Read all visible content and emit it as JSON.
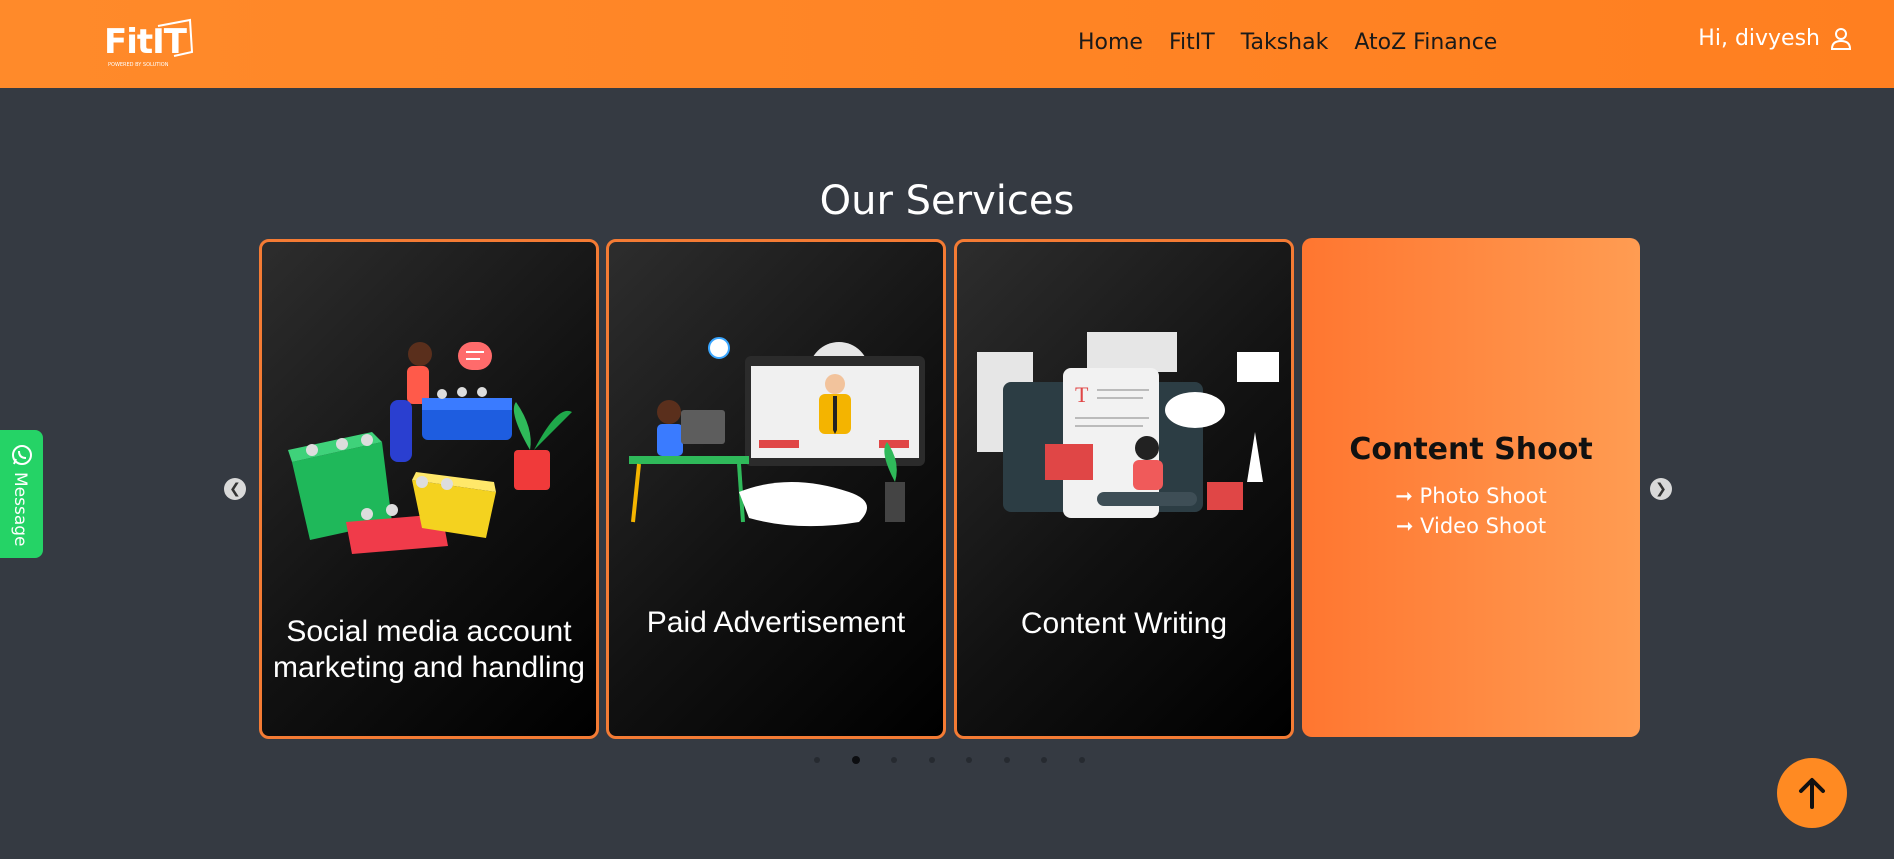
{
  "header": {
    "logo_text": "FitIT",
    "logo_tagline": "POWERED BY SOLUTION",
    "nav": [
      "Home",
      "FitIT",
      "Takshak",
      "AtoZ Finance"
    ],
    "user_greeting": "Hi, divyesh",
    "user_icon": "user-icon"
  },
  "section": {
    "title": "Our Services"
  },
  "cards": [
    {
      "caption_line1": "Social media account",
      "caption_line2": "marketing and handling"
    },
    {
      "caption": "Paid Advertisement"
    },
    {
      "caption": "Content Writing"
    },
    {
      "title": "Content Shoot",
      "items": [
        "➞ Photo Shoot",
        "➞ Video Shoot"
      ]
    }
  ],
  "carousel": {
    "dot_count": 8,
    "active_dot": 2,
    "prev_icon": "chevron-left-icon",
    "next_icon": "chevron-right-icon"
  },
  "message_tab": {
    "label": "Message",
    "icon": "whatsapp-icon"
  },
  "back_to_top": {
    "icon": "arrow-up-icon"
  },
  "colors": {
    "brand": "#ff8a2a",
    "card_border": "#f47b34",
    "whatsapp": "#25d366",
    "background": "#353a42"
  }
}
